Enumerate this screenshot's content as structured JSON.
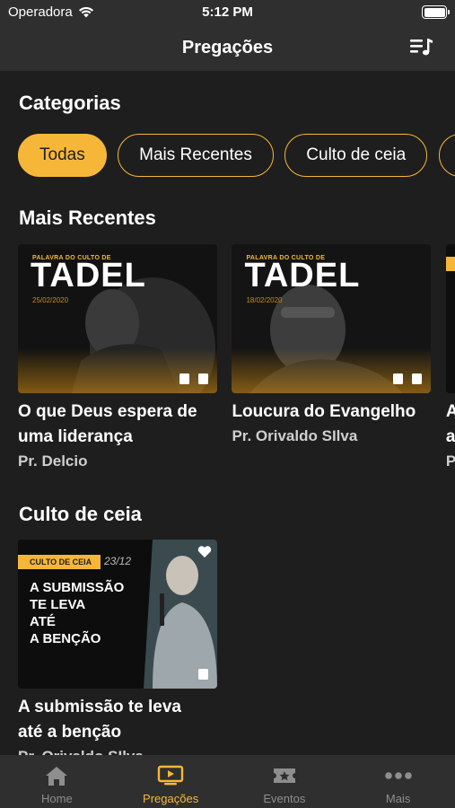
{
  "status": {
    "carrier": "Operadora",
    "time": "5:12 PM"
  },
  "nav": {
    "title": "Pregações"
  },
  "categories": {
    "title": "Categorias",
    "chips": [
      "Todas",
      "Mais Recentes",
      "Culto de ceia"
    ]
  },
  "recent": {
    "title": "Mais Recentes",
    "cards": [
      {
        "title": "O que Deus espera de uma liderança",
        "author": "Pr. Delcio",
        "thumb_top": "PALAVRA DO CULTO DE",
        "thumb_word": "TADEL",
        "thumb_date": "25/02/2020"
      },
      {
        "title": "Loucura do Evangelho",
        "author": "Pr. Orivaldo SIlva",
        "thumb_top": "PALAVRA DO CULTO DE",
        "thumb_word": "TADEL",
        "thumb_date": "18/02/2020"
      },
      {
        "title": "A at",
        "author": "Pr"
      }
    ]
  },
  "ceia": {
    "title": "Culto de ceia",
    "cards": [
      {
        "title": "A submissão te leva até a benção",
        "author": "Pr. Orivaldo SIlva",
        "tag": "CULTO DE CEIA",
        "date": "23/12",
        "lines": [
          "A SUBMISSÃO",
          "TE LEVA",
          "ATÉ",
          "A BENÇÃO"
        ]
      }
    ]
  },
  "tabs": [
    {
      "label": "Home",
      "icon": "house-icon"
    },
    {
      "label": "Pregações",
      "icon": "tv-play-icon"
    },
    {
      "label": "Eventos",
      "icon": "ticket-star-icon"
    },
    {
      "label": "Mais",
      "icon": "ellipsis-icon"
    }
  ],
  "colors": {
    "accent": "#f6b739",
    "background": "#1e1e1e",
    "bar": "#2f2f2f"
  }
}
